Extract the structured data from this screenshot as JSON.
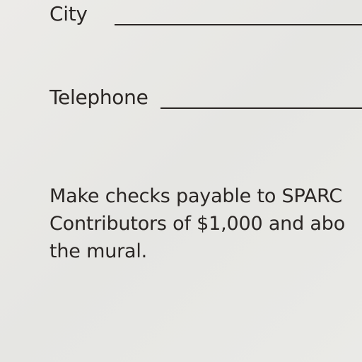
{
  "form": {
    "city_label": "City",
    "telephone_label": "Telephone"
  },
  "note": {
    "line1": "Make checks payable to SPARC",
    "line2": "Contributors of $1,000 and abo",
    "line3": "the mural."
  }
}
